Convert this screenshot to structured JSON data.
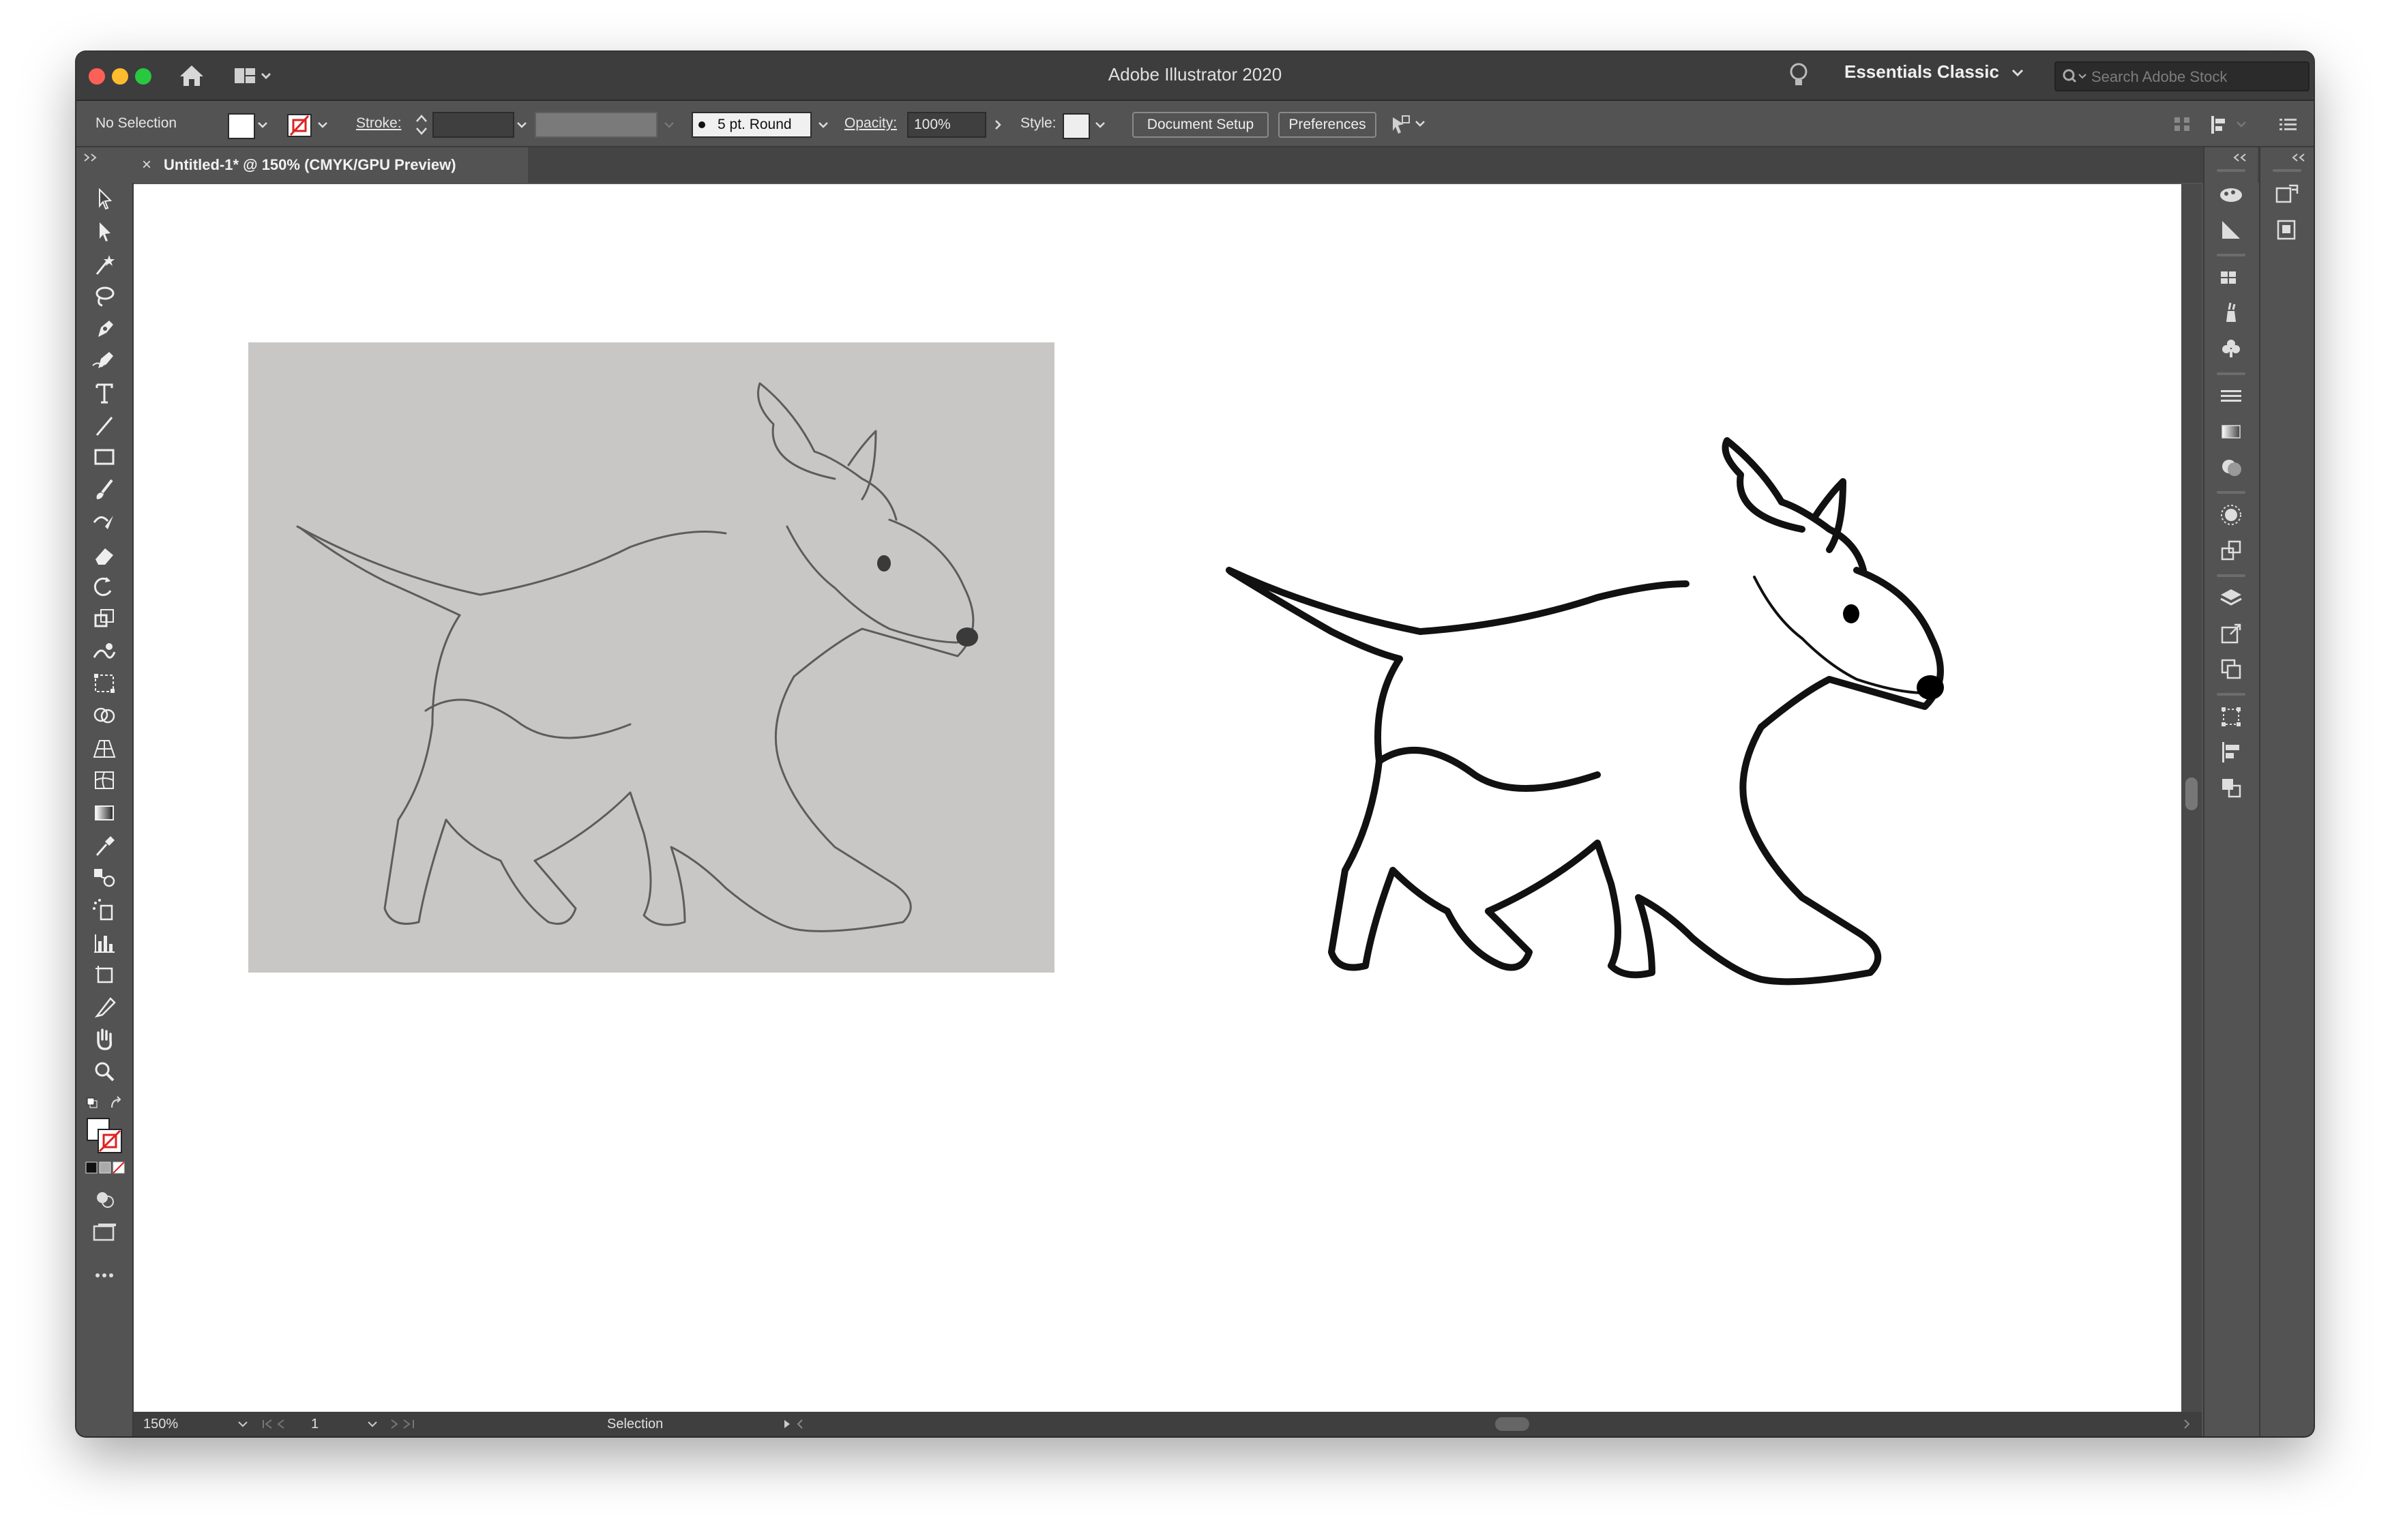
{
  "window": {
    "title": "Adobe Illustrator 2020"
  },
  "header": {
    "workspace": "Essentials Classic",
    "search_placeholder": "Search Adobe Stock"
  },
  "control_bar": {
    "selection": "No Selection",
    "stroke_label": "Stroke:",
    "brush": "5 pt. Round",
    "opacity_label": "Opacity:",
    "opacity_value": "100%",
    "style_label": "Style:",
    "document_setup": "Document Setup",
    "preferences": "Preferences"
  },
  "document_tab": {
    "title": "Untitled-1* @ 150% (CMYK/GPU Preview)",
    "close": "×"
  },
  "status_bar": {
    "zoom": "150%",
    "artboard": "1",
    "tool": "Selection"
  },
  "artwork": {
    "pencil_sketch": "pencil-sketch-photo",
    "vector_trace": "vector-traced-dog"
  },
  "colors": {
    "chrome": "#535353",
    "titlebar": "#3d3d3d",
    "canvas": "#ffffff",
    "photo_bg": "#c9c7c5"
  }
}
